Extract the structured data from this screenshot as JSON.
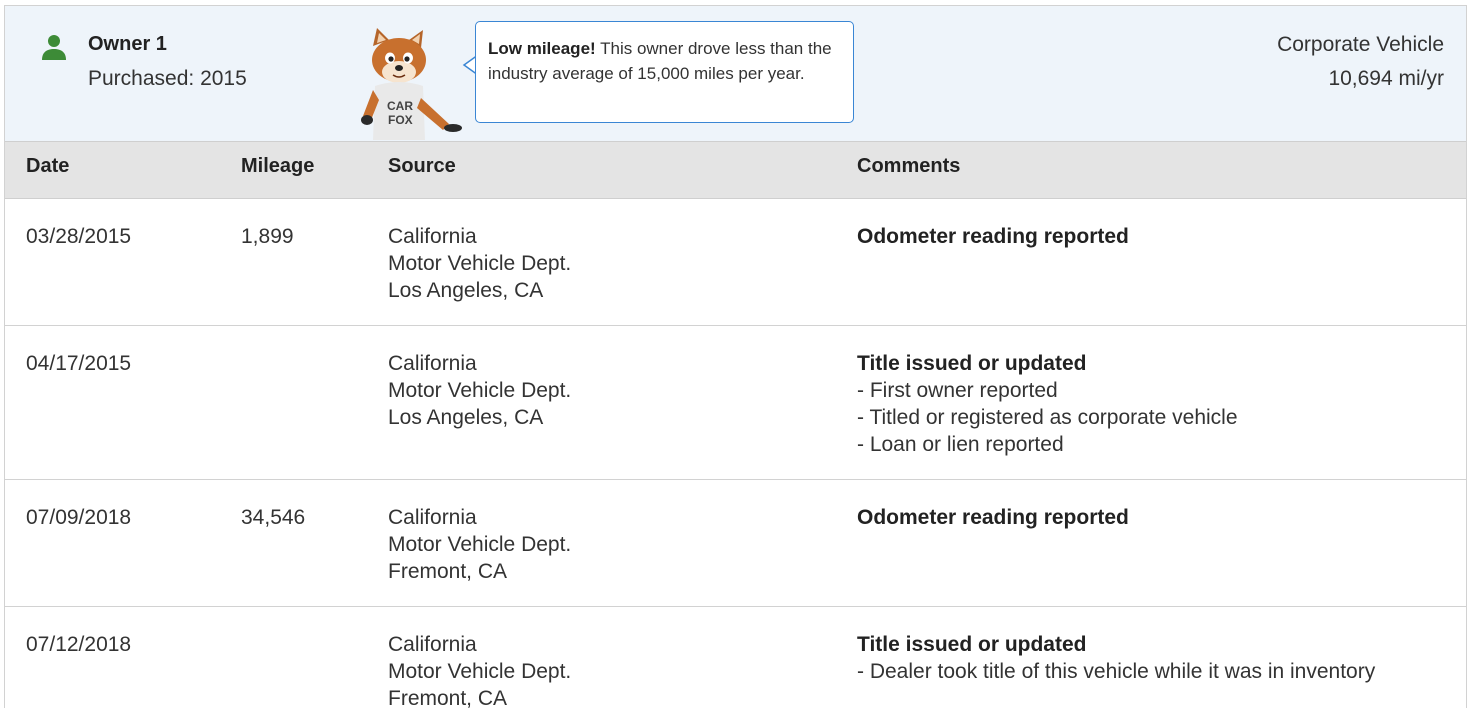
{
  "owner": {
    "name": "Owner 1",
    "purchased": "Purchased: 2015",
    "vehicle_type": "Corporate Vehicle",
    "mileage_rate": "10,694 mi/yr",
    "colors": {
      "icon": "#3d8b37",
      "accent": "#3a86d4"
    }
  },
  "mascot": {
    "shirt_line1": "CAR",
    "shirt_line2": "FOX"
  },
  "bubble": {
    "strong": "Low mileage!",
    "text": " This owner drove less than the industry average of 15,000 miles per year."
  },
  "table": {
    "headers": {
      "date": "Date",
      "mileage": "Mileage",
      "source": "Source",
      "comments": "Comments"
    },
    "rows": [
      {
        "date": "03/28/2015",
        "mileage": "1,899",
        "source": [
          "California",
          "Motor Vehicle Dept.",
          "Los Angeles, CA"
        ],
        "comment_title": "Odometer reading reported",
        "comment_items": []
      },
      {
        "date": "04/17/2015",
        "mileage": "",
        "source": [
          "California",
          "Motor Vehicle Dept.",
          "Los Angeles, CA"
        ],
        "comment_title": "Title issued or updated",
        "comment_items": [
          "- First owner reported",
          "- Titled or registered as corporate vehicle",
          "- Loan or lien reported"
        ]
      },
      {
        "date": "07/09/2018",
        "mileage": "34,546",
        "source": [
          "California",
          "Motor Vehicle Dept.",
          "Fremont, CA"
        ],
        "comment_title": "Odometer reading reported",
        "comment_items": []
      },
      {
        "date": "07/12/2018",
        "mileage": "",
        "source": [
          "California",
          "Motor Vehicle Dept.",
          "Fremont, CA"
        ],
        "comment_title": "Title issued or updated",
        "comment_items": [
          "- Dealer took title of this vehicle while it was in inventory"
        ]
      }
    ]
  }
}
